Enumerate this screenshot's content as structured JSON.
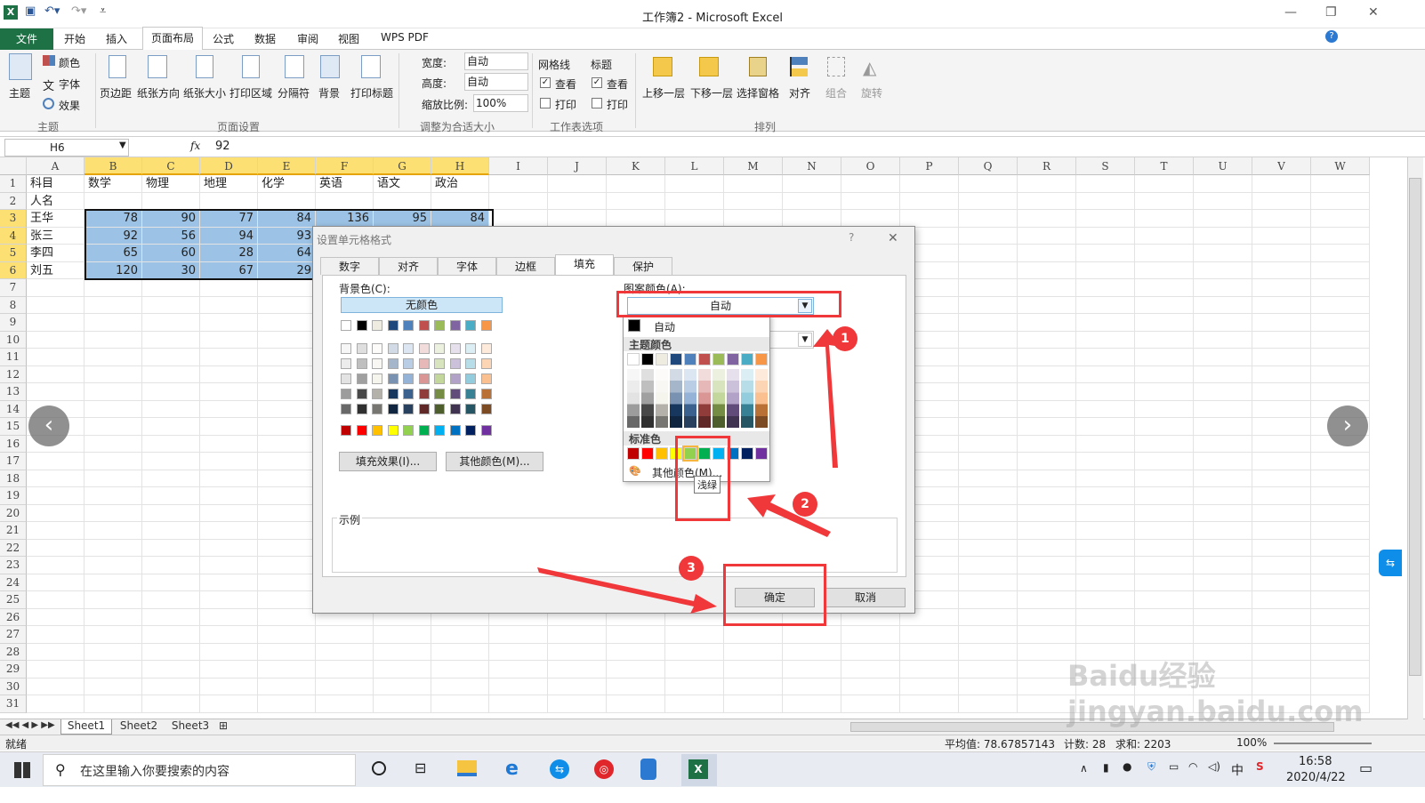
{
  "window": {
    "title": "工作簿2 - Microsoft Excel"
  },
  "ribbon_tabs": [
    "文件",
    "开始",
    "插入",
    "页面布局",
    "公式",
    "数据",
    "审阅",
    "视图",
    "WPS PDF"
  ],
  "ribbon": {
    "theme": {
      "main": "主题",
      "colors": "颜色",
      "fonts": "字体",
      "effects": "效果",
      "group": "主题"
    },
    "page_setup": {
      "items": [
        "页边距",
        "纸张方向",
        "纸张大小",
        "打印区域",
        "分隔符",
        "背景",
        "打印标题"
      ],
      "group": "页面设置"
    },
    "scale": {
      "width_label": "宽度:",
      "width_value": "自动",
      "height_label": "高度:",
      "height_value": "自动",
      "scale_label": "缩放比例:",
      "scale_value": "100%",
      "group": "调整为合适大小"
    },
    "sheet_options": {
      "gridlines": "网格线",
      "headings": "标题",
      "view": "查看",
      "print": "打印",
      "group": "工作表选项"
    },
    "arrange": {
      "items": [
        "上移一层",
        "下移一层",
        "选择窗格",
        "对齐",
        "组合",
        "旋转"
      ],
      "group": "排列"
    }
  },
  "formula_bar": {
    "name_box": "H6",
    "fx": "fx",
    "value": "92"
  },
  "columns": [
    "A",
    "B",
    "C",
    "D",
    "E",
    "F",
    "G",
    "H",
    "I",
    "J",
    "K",
    "L",
    "M",
    "N",
    "O",
    "P",
    "Q",
    "R",
    "S",
    "T",
    "U",
    "V",
    "W"
  ],
  "rows": [
    "1",
    "2",
    "3",
    "4",
    "5",
    "6",
    "7",
    "8",
    "9",
    "10",
    "11",
    "12",
    "13",
    "14",
    "15",
    "16",
    "17",
    "18",
    "19",
    "20",
    "21",
    "22",
    "23",
    "24",
    "25",
    "26",
    "27",
    "28",
    "29",
    "30",
    "31"
  ],
  "cells": [
    [
      "科目",
      "数学",
      "物理",
      "地理",
      "化学",
      "英语",
      "语文",
      "政治"
    ],
    [
      "人名",
      "",
      "",
      "",
      "",
      "",
      "",
      ""
    ],
    [
      "王华",
      "78",
      "90",
      "77",
      "84",
      "136",
      "95",
      "84"
    ],
    [
      "张三",
      "92",
      "56",
      "94",
      "93",
      "",
      "",
      ""
    ],
    [
      "李四",
      "65",
      "60",
      "28",
      "64",
      "",
      "",
      ""
    ],
    [
      "刘五",
      "120",
      "30",
      "67",
      "29",
      "",
      "",
      ""
    ]
  ],
  "sheets": [
    "Sheet1",
    "Sheet2",
    "Sheet3"
  ],
  "status": {
    "ready": "就绪",
    "average": "平均值: 78.67857143",
    "count": "计数: 28",
    "sum": "求和: 2203",
    "zoom": "100%"
  },
  "dialog": {
    "title": "设置单元格格式",
    "help": "?",
    "close": "✕",
    "tabs": [
      "数字",
      "对齐",
      "字体",
      "边框",
      "填充",
      "保护"
    ],
    "bg_color_label": "背景色(C):",
    "no_color": "无颜色",
    "fill_effects": "填充效果(I)...",
    "more_colors": "其他颜色(M)...",
    "pattern_color_label": "图案颜色(A):",
    "pattern_color_value": "自动",
    "sample_label": "示例",
    "ok": "确定",
    "cancel": "取消"
  },
  "popup": {
    "auto": "自动",
    "theme_colors": "主题颜色",
    "standard_colors": "标准色",
    "more_colors": "其他颜色(M)...",
    "tooltip": "浅绿"
  },
  "colors": {
    "theme_top": [
      "#ffffff",
      "#000000",
      "#eeece1",
      "#1f497d",
      "#4f81bd",
      "#c0504d",
      "#9bbb59",
      "#8064a2",
      "#4bacc6",
      "#f79646"
    ],
    "standard": [
      "#c00000",
      "#ff0000",
      "#ffc000",
      "#ffff00",
      "#92d050",
      "#00b050",
      "#00b0f0",
      "#0070c0",
      "#002060",
      "#7030a0"
    ],
    "accent": "#f0383a",
    "selection": "#9cc3e6"
  },
  "annotations": [
    "1",
    "2",
    "3"
  ],
  "taskbar": {
    "search": "在这里输入你要搜索的内容",
    "time": "16:58",
    "date": "2020/4/22",
    "ime": "中"
  },
  "watermark": "Baidu经验 jingyan.baidu.com"
}
